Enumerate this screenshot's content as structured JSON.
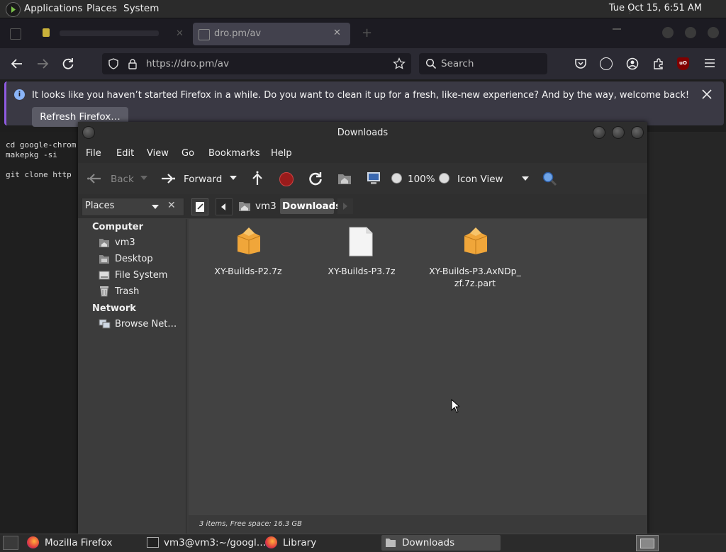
{
  "top_panel": {
    "menus": [
      "Applications",
      "Places",
      "System"
    ],
    "clock": "Tue Oct 15,  6:51 AM"
  },
  "firefox": {
    "tab_title": "dro.pm/av",
    "url": "https://dro.pm/av",
    "search_placeholder": "Search",
    "notification_text": "It looks like you haven’t started Firefox in a while. Do you want to clean it up for a fresh, like-new experience? And by the way, welcome back!",
    "refresh_button": "Refresh Firefox…"
  },
  "terminal": {
    "lines": [
      "cd google-chrom",
      "makepkg -si",
      "",
      "git clone http"
    ]
  },
  "file_manager": {
    "title": "Downloads",
    "menus": [
      "File",
      "Edit",
      "View",
      "Go",
      "Bookmarks",
      "Help"
    ],
    "toolbar": {
      "back": "Back",
      "forward": "Forward",
      "zoom": "100%",
      "view_mode": "Icon View"
    },
    "places_combo": "Places",
    "breadcrumb": [
      "vm3",
      "Downloads"
    ],
    "sidebar": {
      "computer_header": "Computer",
      "computer_items": [
        "vm3",
        "Desktop",
        "File System",
        "Trash"
      ],
      "network_header": "Network",
      "network_items": [
        "Browse Net…"
      ]
    },
    "files": [
      {
        "name": "XY-Builds-P2.7z",
        "icon": "package-icon"
      },
      {
        "name": "XY-Builds-P3.7z",
        "icon": "document-icon"
      },
      {
        "name": "XY-Builds-P3.AxNDp_\nzf.7z.part",
        "icon": "package-icon"
      }
    ],
    "status": "3 items, Free space: 16.3 GB"
  },
  "taskbar": {
    "items": [
      "Mozilla Firefox",
      "vm3@vm3:~/googl…",
      "Library",
      "Downloads"
    ]
  },
  "colors": {
    "firefox_accent": "#8f5ae0",
    "package_orange": "#f0a63a"
  }
}
